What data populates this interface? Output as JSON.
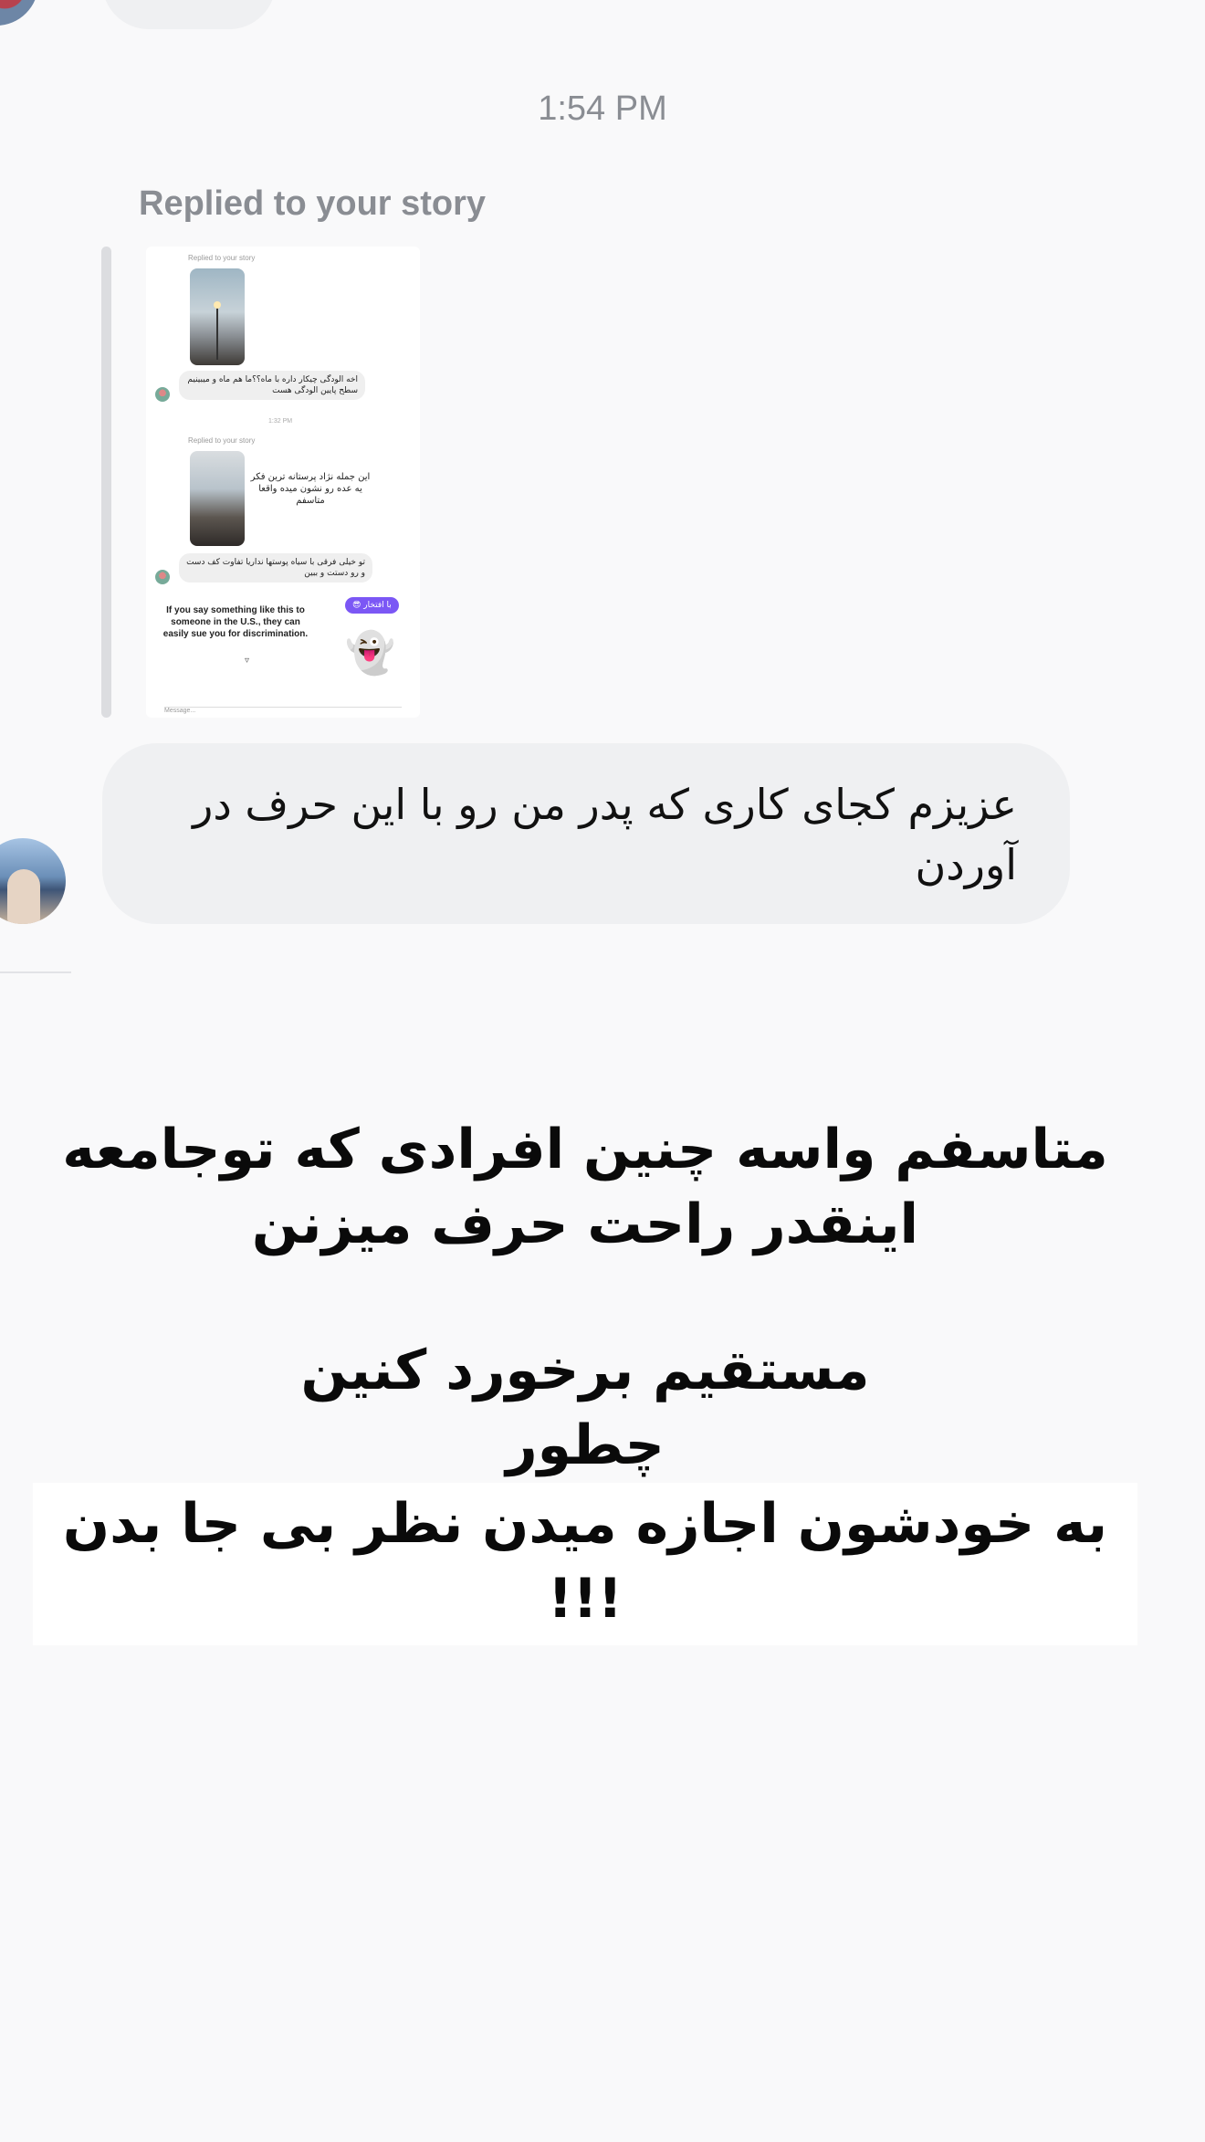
{
  "timestamp": "1:54 PM",
  "reply_label": "Replied to your story",
  "story_preview": {
    "reply_label_1": "Replied to your story",
    "reply_label_2": "Replied to your story",
    "bubble_1": "اخه الودگی چیکار داره با ماه؟؟ما هم ماه و میبینیم سطح پایین الودگی هست",
    "small_time": "1:32 PM",
    "caption": "این جمله نژاد پرستانه ترین فکر یه عده رو نشون میده واقعا متاسفم",
    "bubble_2": "تو خیلی فرقی با سیاه پوستها نداریا تفاوت کف دست و رو دستت و ببین",
    "english_text": "If you say something like this to someone in the U.S., they can easily sue you for discrimination.",
    "chip": "با افتخار 😎",
    "ghost": "👻",
    "message_hint": "Message..."
  },
  "message": "عزیزم کجای کاری که پدر من رو با این حرف در آوردن",
  "overlay": {
    "line1": "متاسفم واسه چنین افرادی که توجامعه",
    "line2": "اینقدر راحت  حرف میزنن",
    "line3": "مستقیم برخورد کنین",
    "line4": "چطور",
    "line5": "به خودشون اجازه میدن نظر بی جا بدن !!!"
  }
}
